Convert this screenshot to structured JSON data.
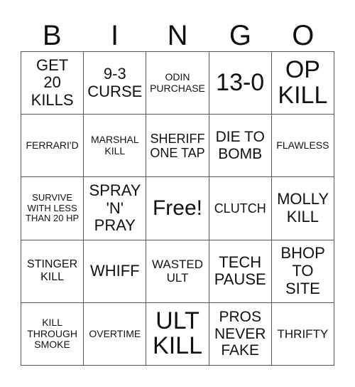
{
  "header": {
    "letters": [
      "B",
      "I",
      "N",
      "G",
      "O"
    ]
  },
  "cells": [
    "GET 20 KILLS",
    "9-3 CURSE",
    "ODIN PURCHASE",
    "13-0",
    "OP KILL",
    "FERRARI'D",
    "MARSHAL KILL",
    "SHERIFF ONE TAP",
    "DIE TO BOMB",
    "FLAWLESS",
    "SURVIVE WITH LESS THAN 20 HP",
    "SPRAY 'N' PRAY",
    "Free!",
    "CLUTCH",
    "MOLLY KILL",
    "STINGER KILL",
    "WHIFF",
    "WASTED ULT",
    "TECH PAUSE",
    "BHOP TO SITE",
    "KILL THROUGH SMOKE",
    "OVERTIME",
    "ULT KILL",
    "PROS NEVER FAKE",
    "THRIFTY"
  ]
}
